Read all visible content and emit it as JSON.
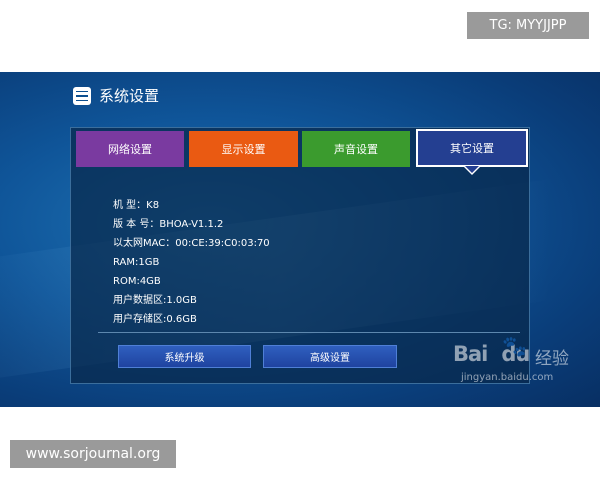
{
  "watermarks": {
    "tag": "TG: MYYJJPP",
    "site": "www.sorjournal.org",
    "baidu_logo": "Bai",
    "baidu_logo_tail": "du",
    "baidu_jingyan": "经验",
    "baidu_url": "jingyan.baidu.com"
  },
  "app": {
    "title": "系统设置",
    "icon": "settings-sliders-icon"
  },
  "tabs": [
    {
      "label": "网络设置",
      "color": "#7a3aa0"
    },
    {
      "label": "显示设置",
      "color": "#ea5a12"
    },
    {
      "label": "声音设置",
      "color": "#3b9b2e"
    },
    {
      "label": "其它设置",
      "color": "#243f91",
      "selected": true
    }
  ],
  "info": [
    "机 型：K8",
    "版 本 号：BHOA-V1.1.2",
    "以太网MAC：00:CE:39:C0:03:70",
    "RAM:1GB",
    "ROM:4GB",
    "用户数据区:1.0GB",
    "用户存储区:0.6GB"
  ],
  "buttons": {
    "upgrade": "系统升级",
    "advanced": "高级设置"
  }
}
